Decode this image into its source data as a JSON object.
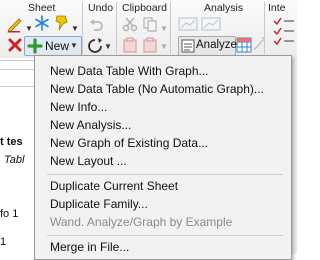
{
  "ribbon": {
    "groups": {
      "sheet": "Sheet",
      "undo": "Undo",
      "clipboard": "Clipboard",
      "analysis": "Analysis",
      "inte": "Inte"
    },
    "new_button_label": "New",
    "analyze_button_label": "Analyze",
    "icons": [
      "pencil-icon",
      "snowflake-icon",
      "pin-icon",
      "delete-x-icon",
      "plus-icon",
      "undo-icon",
      "redo-icon",
      "cut-icon",
      "copy-icon",
      "paste-icon",
      "graph-icon",
      "analyze-icon",
      "table-icon",
      "wand-icon",
      "checklist-icon"
    ],
    "colors": {
      "delete": "#d32020",
      "plus": "#2e9a2e",
      "snowflake": "#1e88e5",
      "pin": "#e6b800"
    }
  },
  "document": {
    "visible_text": [
      "t tes",
      "Tabl",
      "fo 1",
      "1"
    ]
  },
  "menu": {
    "items": [
      {
        "label": "New Data Table With Graph...",
        "enabled": true
      },
      {
        "label": "New Data Table (No Automatic Graph)...",
        "enabled": true
      },
      {
        "label": "New Info...",
        "enabled": true
      },
      {
        "label": "New Analysis...",
        "enabled": true
      },
      {
        "label": "New Graph of Existing Data...",
        "enabled": true
      },
      {
        "label": "New Layout ...",
        "enabled": true
      },
      {
        "label": "Duplicate Current Sheet",
        "enabled": true
      },
      {
        "label": "Duplicate Family...",
        "enabled": true
      },
      {
        "label": "Wand. Analyze/Graph by Example",
        "enabled": false
      },
      {
        "label": "Merge in File...",
        "enabled": true
      }
    ]
  }
}
